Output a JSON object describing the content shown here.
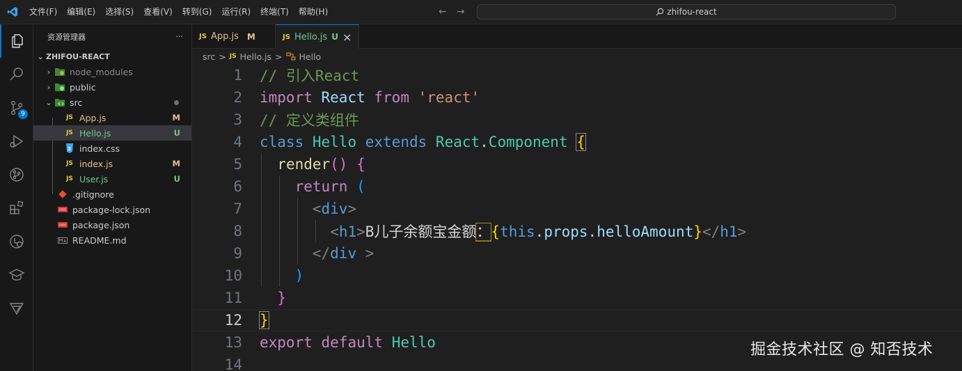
{
  "menu": [
    "文件(F)",
    "编辑(E)",
    "选择(S)",
    "查看(V)",
    "转到(G)",
    "运行(R)",
    "终端(T)",
    "帮助(H)"
  ],
  "search": {
    "text": "zhifou-react"
  },
  "activity": {
    "scm_badge": "9"
  },
  "sidebar": {
    "title": "资源管理器",
    "more": "···",
    "root": "ZHIFOU-REACT",
    "items": [
      {
        "label": "node_modules",
        "status": ""
      },
      {
        "label": "public",
        "status": ""
      },
      {
        "label": "src",
        "status": ""
      },
      {
        "label": "App.js",
        "status": "M"
      },
      {
        "label": "Hello.js",
        "status": "U"
      },
      {
        "label": "index.css",
        "status": ""
      },
      {
        "label": "index.js",
        "status": "M"
      },
      {
        "label": "User.js",
        "status": "U"
      },
      {
        "label": ".gitignore",
        "status": ""
      },
      {
        "label": "package-lock.json",
        "status": ""
      },
      {
        "label": "package.json",
        "status": ""
      },
      {
        "label": "README.md",
        "status": ""
      }
    ]
  },
  "tabs": [
    {
      "badge": "JS",
      "label": "App.js",
      "status": "M"
    },
    {
      "badge": "JS",
      "label": "Hello.js",
      "status": "U",
      "close": "×"
    }
  ],
  "breadcrumb": {
    "folder": "src",
    "file": "Hello.js",
    "symbol": "Hello",
    "sep": ">"
  },
  "code": {
    "line_numbers": [
      "1",
      "2",
      "3",
      "4",
      "5",
      "6",
      "7",
      "8",
      "9",
      "10",
      "11",
      "12",
      "13",
      "14"
    ],
    "l1_comment": "// 引入React",
    "l2_import": "import",
    "l2_react": "React",
    "l2_from": "from",
    "l2_str": "'react'",
    "l3_comment": "// 定义类组件",
    "l4_class": "class",
    "l4_name": "Hello",
    "l4_extends": "extends",
    "l4_react": "React",
    "l4_dot": ".",
    "l4_comp": "Component",
    "l4_brace": "{",
    "l5_render": "render",
    "l5_parens": "()",
    "l5_brace": "{",
    "l6_return": "return",
    "l6_paren": "(",
    "l7_open": "<",
    "l7_tag": "div",
    "l7_close": ">",
    "l8_open": "<",
    "l8_tag": "h1",
    "l8_close": ">",
    "l8_text": "B儿子余额宝金额",
    "l8_colon": "：",
    "l8_lbrace": "{",
    "l8_this": "this",
    "l8_dot1": ".",
    "l8_props": "props",
    "l8_dot2": ".",
    "l8_prop": "helloAmount",
    "l8_rbrace": "}",
    "l8_endopen": "</",
    "l8_endtag": "h1",
    "l8_endclose": ">",
    "l9_open": "</",
    "l9_tag": "div",
    "l9_close": " >",
    "l10_paren": ")",
    "l11_brace": "}",
    "l12_brace": "}",
    "l13_export": "export",
    "l13_default": "default",
    "l13_name": "Hello"
  },
  "watermark": "掘金技术社区 @ 知否技术"
}
